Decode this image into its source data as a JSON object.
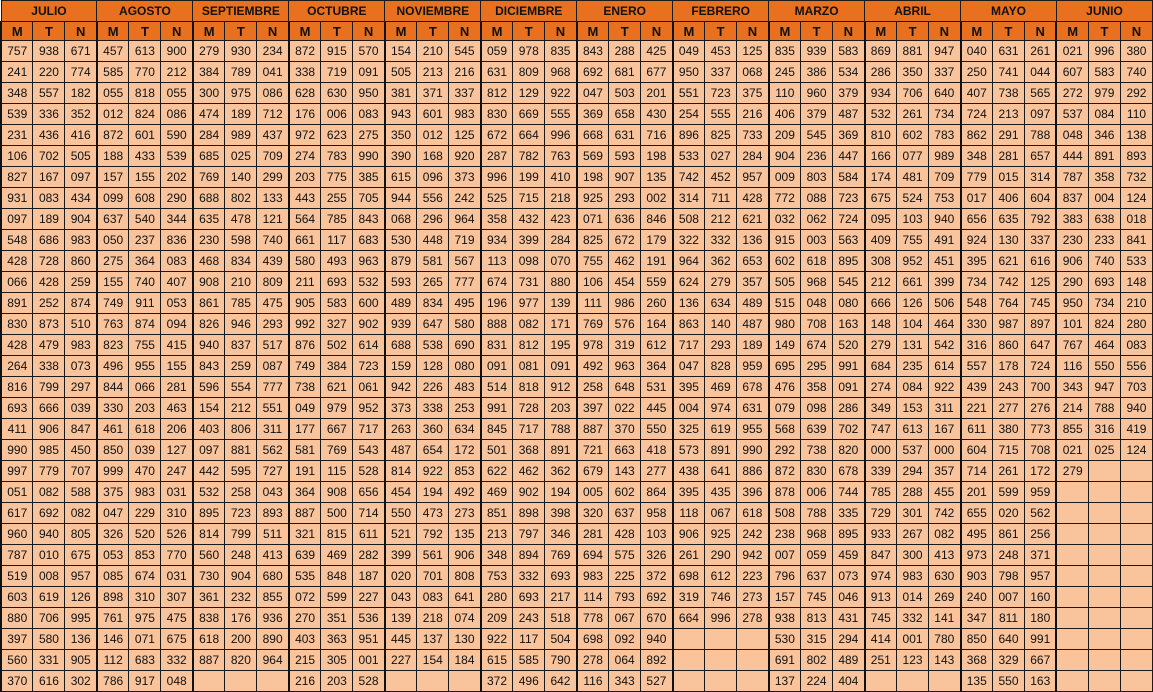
{
  "months": [
    "JULIO",
    "AGOSTO",
    "SEPTIEMBRE",
    "OCTUBRE",
    "NOVIEMBRE",
    "DICIEMBRE",
    "ENERO",
    "FEBRERO",
    "MARZO",
    "ABRIL",
    "MAYO",
    "JUNIO"
  ],
  "shifts": [
    "M",
    "T",
    "N"
  ],
  "rows": [
    [
      "757",
      "938",
      "671",
      "457",
      "613",
      "900",
      "279",
      "930",
      "234",
      "872",
      "915",
      "570",
      "154",
      "210",
      "545",
      "059",
      "978",
      "835",
      "843",
      "288",
      "425",
      "049",
      "453",
      "125",
      "835",
      "939",
      "583",
      "869",
      "881",
      "947",
      "040",
      "631",
      "261",
      "021",
      "996",
      "380"
    ],
    [
      "241",
      "220",
      "774",
      "585",
      "770",
      "212",
      "384",
      "789",
      "041",
      "338",
      "719",
      "091",
      "505",
      "213",
      "216",
      "631",
      "809",
      "968",
      "692",
      "681",
      "677",
      "950",
      "337",
      "068",
      "245",
      "386",
      "534",
      "286",
      "350",
      "337",
      "250",
      "741",
      "044",
      "607",
      "583",
      "740"
    ],
    [
      "348",
      "557",
      "182",
      "055",
      "818",
      "055",
      "300",
      "975",
      "086",
      "628",
      "630",
      "950",
      "381",
      "371",
      "337",
      "812",
      "129",
      "922",
      "047",
      "503",
      "201",
      "551",
      "723",
      "375",
      "110",
      "960",
      "379",
      "934",
      "706",
      "640",
      "407",
      "738",
      "565",
      "272",
      "979",
      "292"
    ],
    [
      "539",
      "336",
      "352",
      "012",
      "824",
      "086",
      "474",
      "189",
      "712",
      "176",
      "006",
      "083",
      "943",
      "601",
      "983",
      "830",
      "669",
      "555",
      "369",
      "658",
      "430",
      "254",
      "555",
      "216",
      "406",
      "379",
      "487",
      "532",
      "261",
      "734",
      "724",
      "213",
      "097",
      "537",
      "084",
      "110"
    ],
    [
      "231",
      "436",
      "416",
      "872",
      "601",
      "590",
      "284",
      "989",
      "437",
      "972",
      "623",
      "275",
      "350",
      "012",
      "125",
      "672",
      "664",
      "996",
      "668",
      "631",
      "716",
      "896",
      "825",
      "733",
      "209",
      "545",
      "369",
      "810",
      "602",
      "783",
      "862",
      "291",
      "788",
      "048",
      "346",
      "138"
    ],
    [
      "106",
      "702",
      "505",
      "188",
      "433",
      "539",
      "685",
      "025",
      "709",
      "274",
      "783",
      "990",
      "390",
      "168",
      "920",
      "287",
      "782",
      "763",
      "569",
      "593",
      "198",
      "533",
      "027",
      "284",
      "904",
      "236",
      "447",
      "166",
      "077",
      "989",
      "348",
      "281",
      "657",
      "444",
      "891",
      "893"
    ],
    [
      "827",
      "167",
      "097",
      "157",
      "155",
      "202",
      "769",
      "140",
      "299",
      "203",
      "775",
      "385",
      "615",
      "096",
      "373",
      "996",
      "199",
      "410",
      "198",
      "907",
      "135",
      "742",
      "452",
      "957",
      "009",
      "803",
      "584",
      "174",
      "481",
      "709",
      "779",
      "015",
      "314",
      "787",
      "358",
      "732"
    ],
    [
      "931",
      "083",
      "434",
      "099",
      "608",
      "290",
      "688",
      "802",
      "133",
      "443",
      "255",
      "705",
      "944",
      "556",
      "242",
      "525",
      "715",
      "218",
      "925",
      "293",
      "002",
      "314",
      "711",
      "428",
      "772",
      "088",
      "723",
      "675",
      "524",
      "753",
      "017",
      "406",
      "604",
      "837",
      "004",
      "124"
    ],
    [
      "097",
      "189",
      "904",
      "637",
      "540",
      "344",
      "635",
      "478",
      "121",
      "564",
      "785",
      "843",
      "068",
      "296",
      "964",
      "358",
      "432",
      "423",
      "071",
      "636",
      "846",
      "508",
      "212",
      "621",
      "032",
      "062",
      "724",
      "095",
      "103",
      "940",
      "656",
      "635",
      "792",
      "383",
      "638",
      "018"
    ],
    [
      "548",
      "686",
      "983",
      "050",
      "237",
      "836",
      "230",
      "598",
      "740",
      "661",
      "117",
      "683",
      "530",
      "448",
      "719",
      "934",
      "399",
      "284",
      "825",
      "672",
      "179",
      "322",
      "332",
      "136",
      "915",
      "003",
      "563",
      "409",
      "755",
      "491",
      "924",
      "130",
      "337",
      "230",
      "233",
      "841"
    ],
    [
      "428",
      "728",
      "860",
      "275",
      "364",
      "083",
      "468",
      "834",
      "439",
      "580",
      "493",
      "963",
      "879",
      "581",
      "567",
      "113",
      "098",
      "070",
      "755",
      "462",
      "191",
      "964",
      "362",
      "653",
      "602",
      "618",
      "895",
      "308",
      "952",
      "451",
      "395",
      "621",
      "616",
      "906",
      "740",
      "533"
    ],
    [
      "066",
      "428",
      "259",
      "155",
      "740",
      "407",
      "908",
      "210",
      "809",
      "211",
      "693",
      "532",
      "593",
      "265",
      "777",
      "674",
      "731",
      "880",
      "106",
      "454",
      "559",
      "624",
      "279",
      "357",
      "505",
      "968",
      "545",
      "212",
      "661",
      "399",
      "734",
      "742",
      "125",
      "290",
      "693",
      "148"
    ],
    [
      "891",
      "252",
      "874",
      "749",
      "911",
      "053",
      "861",
      "785",
      "475",
      "905",
      "583",
      "600",
      "489",
      "834",
      "495",
      "196",
      "977",
      "139",
      "111",
      "986",
      "260",
      "136",
      "634",
      "489",
      "515",
      "048",
      "080",
      "666",
      "126",
      "506",
      "548",
      "764",
      "745",
      "950",
      "734",
      "210"
    ],
    [
      "830",
      "873",
      "510",
      "763",
      "874",
      "094",
      "826",
      "946",
      "293",
      "992",
      "327",
      "902",
      "939",
      "647",
      "580",
      "888",
      "082",
      "171",
      "769",
      "576",
      "164",
      "863",
      "140",
      "487",
      "980",
      "708",
      "163",
      "148",
      "104",
      "464",
      "330",
      "987",
      "897",
      "101",
      "824",
      "280"
    ],
    [
      "428",
      "479",
      "983",
      "823",
      "755",
      "415",
      "940",
      "837",
      "517",
      "876",
      "502",
      "614",
      "688",
      "538",
      "690",
      "831",
      "812",
      "195",
      "978",
      "319",
      "612",
      "717",
      "293",
      "189",
      "149",
      "674",
      "520",
      "279",
      "131",
      "542",
      "316",
      "860",
      "647",
      "767",
      "464",
      "083"
    ],
    [
      "264",
      "338",
      "073",
      "496",
      "955",
      "155",
      "843",
      "259",
      "087",
      "749",
      "384",
      "723",
      "159",
      "128",
      "080",
      "091",
      "081",
      "091",
      "492",
      "963",
      "364",
      "047",
      "828",
      "959",
      "695",
      "295",
      "991",
      "684",
      "235",
      "614",
      "557",
      "178",
      "724",
      "116",
      "550",
      "556"
    ],
    [
      "816",
      "799",
      "297",
      "844",
      "066",
      "281",
      "596",
      "554",
      "777",
      "738",
      "621",
      "061",
      "942",
      "226",
      "483",
      "514",
      "818",
      "912",
      "258",
      "648",
      "531",
      "395",
      "469",
      "678",
      "476",
      "358",
      "091",
      "274",
      "084",
      "922",
      "439",
      "243",
      "700",
      "343",
      "947",
      "703"
    ],
    [
      "693",
      "666",
      "039",
      "330",
      "203",
      "463",
      "154",
      "212",
      "551",
      "049",
      "979",
      "952",
      "373",
      "338",
      "253",
      "991",
      "728",
      "203",
      "397",
      "022",
      "445",
      "004",
      "974",
      "631",
      "079",
      "098",
      "286",
      "349",
      "153",
      "311",
      "221",
      "277",
      "276",
      "214",
      "788",
      "940"
    ],
    [
      "411",
      "906",
      "847",
      "461",
      "618",
      "206",
      "403",
      "806",
      "311",
      "177",
      "667",
      "717",
      "263",
      "360",
      "634",
      "845",
      "717",
      "788",
      "887",
      "370",
      "550",
      "325",
      "619",
      "955",
      "568",
      "639",
      "702",
      "747",
      "613",
      "167",
      "611",
      "380",
      "773",
      "855",
      "316",
      "419"
    ],
    [
      "990",
      "985",
      "450",
      "850",
      "039",
      "127",
      "097",
      "881",
      "562",
      "581",
      "769",
      "543",
      "487",
      "654",
      "172",
      "501",
      "368",
      "891",
      "721",
      "663",
      "418",
      "573",
      "891",
      "990",
      "292",
      "738",
      "820",
      "000",
      "537",
      "000",
      "604",
      "715",
      "708",
      "021",
      "025",
      "124"
    ],
    [
      "997",
      "779",
      "707",
      "999",
      "470",
      "247",
      "442",
      "595",
      "727",
      "191",
      "115",
      "528",
      "814",
      "922",
      "853",
      "622",
      "462",
      "362",
      "679",
      "143",
      "277",
      "438",
      "641",
      "886",
      "872",
      "830",
      "678",
      "339",
      "294",
      "357",
      "714",
      "261",
      "172",
      "279",
      "",
      ""
    ],
    [
      "051",
      "082",
      "588",
      "375",
      "983",
      "031",
      "532",
      "258",
      "043",
      "364",
      "908",
      "656",
      "454",
      "194",
      "492",
      "469",
      "902",
      "194",
      "005",
      "602",
      "864",
      "395",
      "435",
      "396",
      "878",
      "006",
      "744",
      "785",
      "288",
      "455",
      "201",
      "599",
      "959",
      "",
      "",
      ""
    ],
    [
      "617",
      "692",
      "082",
      "047",
      "229",
      "310",
      "895",
      "723",
      "893",
      "887",
      "500",
      "714",
      "550",
      "473",
      "273",
      "851",
      "898",
      "398",
      "320",
      "637",
      "958",
      "118",
      "067",
      "618",
      "508",
      "788",
      "335",
      "729",
      "301",
      "742",
      "655",
      "020",
      "562",
      "",
      "",
      ""
    ],
    [
      "960",
      "940",
      "805",
      "326",
      "520",
      "526",
      "814",
      "799",
      "511",
      "321",
      "815",
      "611",
      "521",
      "792",
      "135",
      "213",
      "797",
      "346",
      "281",
      "428",
      "103",
      "906",
      "925",
      "242",
      "238",
      "968",
      "895",
      "933",
      "267",
      "082",
      "495",
      "861",
      "256",
      "",
      "",
      ""
    ],
    [
      "787",
      "010",
      "675",
      "053",
      "853",
      "770",
      "560",
      "248",
      "413",
      "639",
      "469",
      "282",
      "399",
      "561",
      "906",
      "348",
      "894",
      "769",
      "694",
      "575",
      "326",
      "261",
      "290",
      "942",
      "007",
      "059",
      "459",
      "847",
      "300",
      "413",
      "973",
      "248",
      "371",
      "",
      "",
      ""
    ],
    [
      "519",
      "008",
      "957",
      "085",
      "674",
      "031",
      "730",
      "904",
      "680",
      "535",
      "848",
      "187",
      "020",
      "701",
      "808",
      "753",
      "332",
      "693",
      "983",
      "225",
      "372",
      "698",
      "612",
      "223",
      "796",
      "637",
      "073",
      "974",
      "983",
      "630",
      "903",
      "798",
      "957",
      "",
      "",
      ""
    ],
    [
      "603",
      "619",
      "126",
      "898",
      "310",
      "307",
      "361",
      "232",
      "855",
      "072",
      "599",
      "227",
      "043",
      "083",
      "641",
      "280",
      "693",
      "217",
      "114",
      "793",
      "692",
      "319",
      "746",
      "273",
      "157",
      "745",
      "046",
      "913",
      "014",
      "269",
      "240",
      "007",
      "160",
      "",
      "",
      ""
    ],
    [
      "880",
      "706",
      "995",
      "761",
      "975",
      "475",
      "838",
      "176",
      "936",
      "270",
      "351",
      "536",
      "139",
      "218",
      "074",
      "209",
      "243",
      "518",
      "778",
      "067",
      "670",
      "664",
      "996",
      "278",
      "938",
      "813",
      "431",
      "745",
      "332",
      "141",
      "347",
      "811",
      "180",
      "",
      "",
      ""
    ],
    [
      "397",
      "580",
      "136",
      "146",
      "071",
      "675",
      "618",
      "200",
      "890",
      "403",
      "363",
      "951",
      "445",
      "137",
      "130",
      "922",
      "117",
      "504",
      "698",
      "092",
      "940",
      "",
      "",
      "",
      "530",
      "315",
      "294",
      "414",
      "001",
      "780",
      "850",
      "640",
      "991",
      "",
      "",
      ""
    ],
    [
      "560",
      "331",
      "905",
      "112",
      "683",
      "332",
      "887",
      "820",
      "964",
      "215",
      "305",
      "001",
      "227",
      "154",
      "184",
      "615",
      "585",
      "790",
      "278",
      "064",
      "892",
      "",
      "",
      "",
      "691",
      "802",
      "489",
      "251",
      "123",
      "143",
      "368",
      "329",
      "667",
      "",
      "",
      ""
    ],
    [
      "370",
      "616",
      "302",
      "786",
      "917",
      "048",
      "",
      "",
      "",
      "216",
      "203",
      "528",
      "",
      "",
      "",
      "372",
      "496",
      "642",
      "116",
      "343",
      "527",
      "",
      "",
      "",
      "137",
      "224",
      "404",
      "",
      "",
      "",
      "135",
      "550",
      "163",
      "",
      "",
      ""
    ]
  ]
}
